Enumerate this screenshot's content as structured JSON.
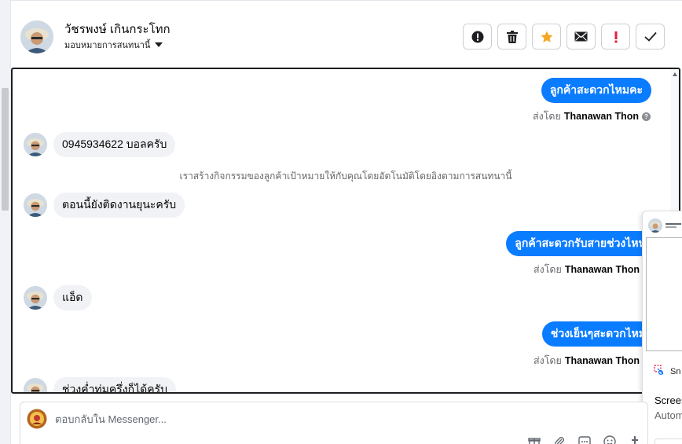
{
  "header": {
    "contact_name": "วัชรพงษ์ เกินกระโทก",
    "assign_label": "มอบหมายการสนทนานี้",
    "actions": [
      {
        "name": "report-spam-button",
        "icon": "alert-circle-icon"
      },
      {
        "name": "delete-button",
        "icon": "trash-icon"
      },
      {
        "name": "star-button",
        "icon": "star-icon"
      },
      {
        "name": "mark-unread-button",
        "icon": "envelope-icon"
      },
      {
        "name": "follow-up-button",
        "icon": "exclamation-icon"
      },
      {
        "name": "mark-done-button",
        "icon": "checkmark-icon"
      }
    ],
    "colors": {
      "star": "#f5a623",
      "alert": "#e41e3f"
    }
  },
  "messages": [
    {
      "direction": "out",
      "text": "ลูกค้าสะดวกไหมคะ",
      "sent_by_prefix": "ส่งโดย",
      "sent_by_name": "Thanawan Thon"
    },
    {
      "direction": "in",
      "text": "0945934622 บอลครับ"
    },
    {
      "direction": "system",
      "text": "เราสร้างกิจกรรมของลูกค้าเป้าหมายให้กับคุณโดยอัตโนมัติโดยอิงตามการสนทนานี้"
    },
    {
      "direction": "in",
      "text": "ตอนนี้ยังติดงานยุนะครับ"
    },
    {
      "direction": "out",
      "text": "ลูกค้าสะดวกรับสายช่วงไหนคะ",
      "sent_by_prefix": "ส่งโดย",
      "sent_by_name": "Thanawan Thon"
    },
    {
      "direction": "in",
      "text": "แอ็ด"
    },
    {
      "direction": "out",
      "text": "ช่วงเย็นๆสะดวกไหมคะ",
      "sent_by_prefix": "ส่งโดย",
      "sent_by_name": "Thanawan Thon"
    },
    {
      "direction": "in",
      "text": "ช่วงค่ำทุ่มครึ่งก็ได้ครับ"
    }
  ],
  "overlay": {
    "app_label": "Sn",
    "title": "Screen",
    "subtitle": "Autom"
  },
  "composer": {
    "placeholder": "ตอบกลับใน Messenger..."
  },
  "colors": {
    "outgoing_bubble": "#0a7cff",
    "incoming_bubble": "#f0f2f5"
  }
}
